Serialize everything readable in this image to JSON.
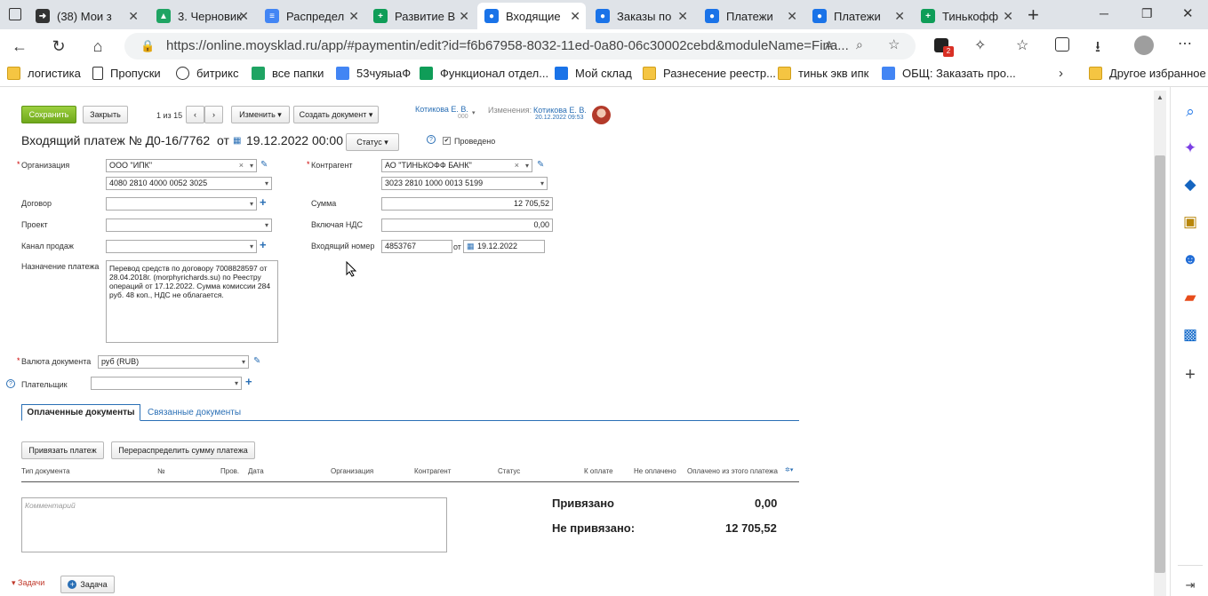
{
  "tabs": [
    {
      "label": "(38) Мои з",
      "fav_color": "#333",
      "fav": "➜"
    },
    {
      "label": "3. Черновик",
      "fav_color": "#1fa463",
      "fav": "▲"
    },
    {
      "label": "Распредел",
      "fav_color": "#4285f4",
      "fav": "≡"
    },
    {
      "label": "Развитие В",
      "fav_color": "#0f9d58",
      "fav": "+"
    },
    {
      "label": "Входящие",
      "fav_color": "#1a73e8",
      "fav": "●"
    },
    {
      "label": "Заказы по",
      "fav_color": "#1a73e8",
      "fav": "●"
    },
    {
      "label": "Платежи",
      "fav_color": "#1a73e8",
      "fav": "●"
    },
    {
      "label": "Платежи",
      "fav_color": "#1a73e8",
      "fav": "●"
    },
    {
      "label": "Тинькофф",
      "fav_color": "#0f9d58",
      "fav": "+"
    }
  ],
  "window": {
    "minimize": "─",
    "restore": "❐",
    "close": "✕",
    "new_tab": "+"
  },
  "address": {
    "url": "https://online.moysklad.ru/app/#paymentin/edit?id=f6b67958-8032-11ed-0a80-06c30002cebd&moduleName=Fina..."
  },
  "extensions": {
    "badge": "2"
  },
  "bookmarks": [
    {
      "label": "логистика",
      "icon": "folder"
    },
    {
      "label": "Пропуски",
      "icon": "page"
    },
    {
      "label": "битрикс",
      "icon": "arrow"
    },
    {
      "label": "все папки",
      "icon": "drive"
    },
    {
      "label": "53чуяыаФ",
      "icon": "doc"
    },
    {
      "label": "Функционал отдел...",
      "icon": "sheet"
    },
    {
      "label": "Мой склад",
      "icon": "ms"
    },
    {
      "label": "Разнесение реестр...",
      "icon": "folder"
    },
    {
      "label": "тиньк экв ипк",
      "icon": "folder"
    },
    {
      "label": "ОБЩ: Заказать про...",
      "icon": "doc"
    },
    {
      "label": "Другое избранное",
      "icon": "folder"
    }
  ],
  "toolbar": {
    "save": "Сохранить",
    "close": "Закрыть",
    "pager": "1 из 15",
    "change": "Изменить",
    "create_doc": "Создать документ",
    "owner_name": "Котикова Е. В.",
    "owner_sub": "000",
    "changes_label": "Изменения:",
    "changes_name": "Котикова Е. В.",
    "changes_date": "20.12.2022 09:53"
  },
  "doc": {
    "title_prefix": "Входящий платеж №",
    "number": "Д0-16/7762",
    "from": "от",
    "date": "19.12.2022 00:00",
    "status": "Статус",
    "posted": "Проведено"
  },
  "form": {
    "org_label": "Организация",
    "org_value": "ООО \"ИПК\"",
    "org_account": "4080 2810 4000 0052 3025",
    "contract_label": "Договор",
    "project_label": "Проект",
    "channel_label": "Канал продаж",
    "purpose_label": "Назначение платежа",
    "purpose_value": "Перевод средств по договору 7008828597 от 28.04.2018г. (morphyrichards.su) по Реестру операций от 17.12.2022. Сумма комиссии 284 руб. 48 коп., НДС не облагается.",
    "contractor_label": "Контрагент",
    "contractor_value": "АО \"ТИНЬКОФФ БАНК\"",
    "contractor_account": "3023 2810 1000 0013 5199",
    "sum_label": "Сумма",
    "sum_value": "12 705,52",
    "vat_label": "Включая НДС",
    "vat_value": "0,00",
    "incoming_label": "Входящий номер",
    "incoming_value": "4853767",
    "incoming_from": "от",
    "incoming_date": "19.12.2022",
    "currency_label": "Валюта документа",
    "currency_value": "руб (RUB)",
    "payer_label": "Плательщик"
  },
  "subtabs": {
    "paid": "Оплаченные документы",
    "linked": "Связанные документы"
  },
  "actions": {
    "bind": "Привязать платеж",
    "redistribute": "Перераспределить сумму платежа"
  },
  "table_headers": [
    "Тип документа",
    "№",
    "Пров.",
    "Дата",
    "Организация",
    "Контрагент",
    "Статус",
    "К оплате",
    "Не оплачено",
    "Оплачено из этого платежа"
  ],
  "comment_placeholder": "Комментарий",
  "totals": {
    "bound_label": "Привязано",
    "bound_value": "0,00",
    "unbound_label": "Не привязано:",
    "unbound_value": "12 705,52"
  },
  "footer": {
    "tasks": "Задачи",
    "task_btn": "Задача"
  }
}
